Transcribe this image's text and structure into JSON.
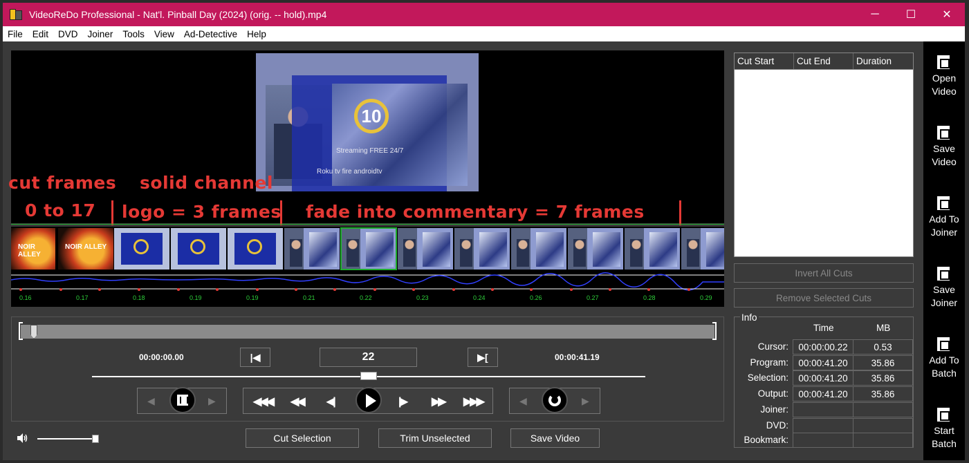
{
  "window": {
    "title": "VideoReDo Professional - Nat'l. Pinball Day (2024) (orig. -- hold).mp4",
    "minimize": "─",
    "maximize": "☐",
    "close": "✕"
  },
  "menu": [
    "File",
    "Edit",
    "DVD",
    "Joiner",
    "Tools",
    "View",
    "Ad-Detective",
    "Help"
  ],
  "video": {
    "overlay_text": "Streaming FREE 24/7",
    "overlay_brands": "Roku  tv  fire  androidtv",
    "channel_logo": "10"
  },
  "annotations": {
    "line1a": "cut frames",
    "line1b": "solid channel",
    "line2a": "0 to 17",
    "line2b": "logo = 3 frames",
    "line2c": "fade into commentary = 7 frames"
  },
  "thumbnails": {
    "noir_label": "NOIR ALLEY",
    "selected_index": 6
  },
  "timeline_ticks": [
    "0.16",
    "0.17",
    "0.18",
    "0.19",
    "0.19",
    "0.21",
    "0.22",
    "0.23",
    "0.24",
    "0.26",
    "0.27",
    "0.28",
    "0.29"
  ],
  "controls": {
    "start_time": "00:00:00.00",
    "end_time": "00:00:41.19",
    "frame_number": "22",
    "go_start": "|◀",
    "go_end": "▶[",
    "cut_selection": "Cut Selection",
    "trim_unselected": "Trim Unselected",
    "save_video": "Save Video"
  },
  "cut_list": {
    "columns": [
      "Cut Start",
      "Cut End",
      "Duration"
    ],
    "invert_all_cuts": "Invert All Cuts",
    "remove_selected_cuts": "Remove Selected Cuts"
  },
  "info": {
    "title": "Info",
    "col_time": "Time",
    "col_mb": "MB",
    "rows": [
      {
        "label": "Cursor:",
        "time": "00:00:00.22",
        "mb": "0.53"
      },
      {
        "label": "Program:",
        "time": "00:00:41.20",
        "mb": "35.86"
      },
      {
        "label": "Selection:",
        "time": "00:00:41.20",
        "mb": "35.86"
      },
      {
        "label": "Output:",
        "time": "00:00:41.20",
        "mb": "35.86"
      },
      {
        "label": "Joiner:",
        "time": "",
        "mb": ""
      },
      {
        "label": "DVD:",
        "time": "",
        "mb": ""
      },
      {
        "label": "Bookmark:",
        "time": "",
        "mb": ""
      }
    ]
  },
  "right_toolbar": [
    {
      "line1": "Open",
      "line2": "Video",
      "icon": "open-video-icon"
    },
    {
      "line1": "Save",
      "line2": "Video",
      "icon": "save-video-icon"
    },
    {
      "line1": "Add To",
      "line2": "Joiner",
      "icon": "add-to-joiner-icon"
    },
    {
      "line1": "Save",
      "line2": "Joiner",
      "icon": "save-joiner-icon"
    },
    {
      "line1": "Add To",
      "line2": "Batch",
      "icon": "add-to-batch-icon"
    },
    {
      "line1": "Start",
      "line2": "Batch",
      "icon": "start-batch-icon"
    }
  ]
}
